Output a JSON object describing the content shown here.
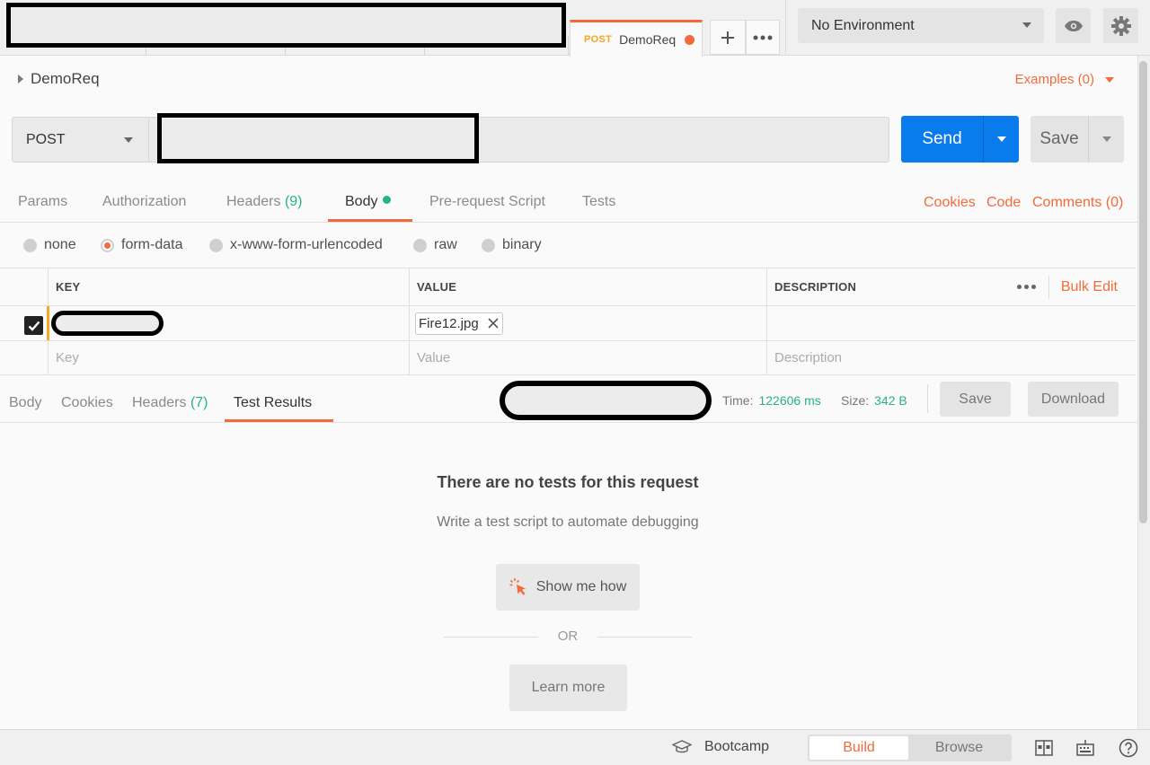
{
  "tabs": {
    "active": {
      "method": "POST",
      "name": "DemoReq"
    },
    "new_tab_icon": "plus-icon",
    "more_icon": "more-horizontal-icon"
  },
  "environment": {
    "selected": "No Environment",
    "eye_icon": "eye-icon",
    "settings_icon": "gear-icon"
  },
  "request": {
    "name": "DemoReq",
    "examples_label": "Examples (0)",
    "method": "POST",
    "send_label": "Send",
    "save_label": "Save"
  },
  "request_tabs": {
    "params": "Params",
    "authorization": "Authorization",
    "headers": "Headers",
    "headers_count": "(9)",
    "body": "Body",
    "pre_request": "Pre-request Script",
    "tests": "Tests",
    "cookies": "Cookies",
    "code": "Code",
    "comments": "Comments (0)"
  },
  "body_types": {
    "none": "none",
    "form_data": "form-data",
    "urlencoded": "x-www-form-urlencoded",
    "raw": "raw",
    "binary": "binary",
    "selected": "form-data"
  },
  "form_table": {
    "headers": {
      "key": "KEY",
      "value": "VALUE",
      "description": "DESCRIPTION",
      "bulk_edit": "Bulk Edit"
    },
    "rows": [
      {
        "checked": true,
        "key": "",
        "value_file": "Fire12.jpg",
        "description": ""
      }
    ],
    "placeholders": {
      "key": "Key",
      "value": "Value",
      "description": "Description"
    }
  },
  "response": {
    "tabs": {
      "body": "Body",
      "cookies": "Cookies",
      "headers": "Headers",
      "headers_count": "(7)",
      "test_results": "Test Results"
    },
    "time_label": "Time:",
    "time_value": "122606 ms",
    "size_label": "Size:",
    "size_value": "342 B",
    "save_label": "Save",
    "download_label": "Download"
  },
  "empty_state": {
    "title": "There are no tests for this request",
    "subtitle": "Write a test script to automate debugging",
    "show_me_label": "Show me how",
    "or_label": "OR",
    "learn_more_label": "Learn more"
  },
  "statusbar": {
    "bootcamp": "Bootcamp",
    "build": "Build",
    "browse": "Browse"
  },
  "colors": {
    "accent": "#f26b3a",
    "primary": "#097bed",
    "success": "#26b47f",
    "warning": "#f5a623"
  }
}
